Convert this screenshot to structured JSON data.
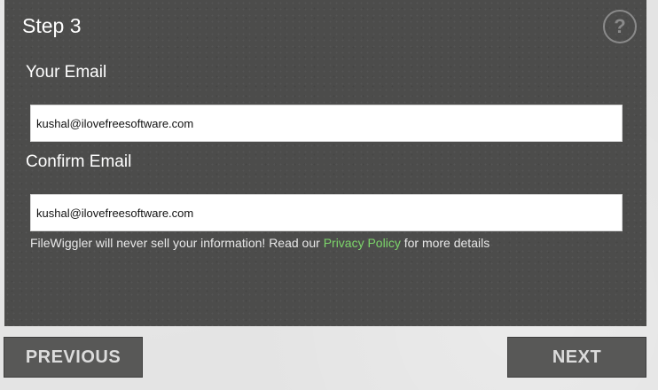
{
  "step": {
    "title": "Step 3",
    "help_glyph": "?"
  },
  "form": {
    "email_label": "Your Email",
    "email_value": "kushal@ilovefreesoftware.com",
    "confirm_label": "Confirm Email",
    "confirm_value": "kushal@ilovefreesoftware.com"
  },
  "notice": {
    "prefix": "FileWiggler will never sell your information! Read our ",
    "link": "Privacy Policy",
    "suffix": " for more details"
  },
  "nav": {
    "previous_label": "PREVIOUS",
    "next_label": "NEXT"
  },
  "colors": {
    "panel": "#4c4c4b",
    "link": "#7cd56a",
    "button": "#585857"
  }
}
